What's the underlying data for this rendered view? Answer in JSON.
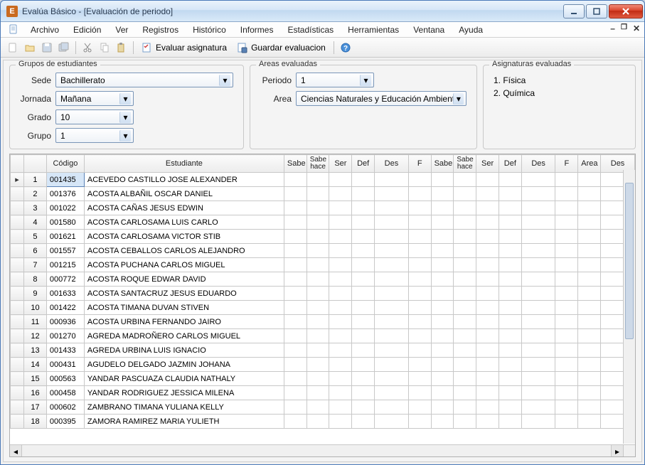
{
  "window": {
    "title": "Evalúa Básico - [Evaluación de periodo]"
  },
  "menu": [
    "Archivo",
    "Edición",
    "Ver",
    "Registros",
    "Histórico",
    "Informes",
    "Estadísticas",
    "Herramientas",
    "Ventana",
    "Ayuda"
  ],
  "toolbar": {
    "evaluar": "Evaluar asignatura",
    "guardar": "Guardar evaluacion"
  },
  "groups": {
    "grupos_title": "Grupos de estudiantes",
    "sede_label": "Sede",
    "sede_value": "Bachillerato",
    "jornada_label": "Jornada",
    "jornada_value": "Mañana",
    "grado_label": "Grado",
    "grado_value": "10",
    "grupo_label": "Grupo",
    "grupo_value": "1"
  },
  "areas": {
    "title": "Areas evaluadas",
    "periodo_label": "Periodo",
    "periodo_value": "1",
    "area_label": "Area",
    "area_value": "Ciencias Naturales y Educación Ambiental"
  },
  "subjects": {
    "title": "Asignaturas evaluadas",
    "items": [
      "1. Física",
      "2. Química"
    ]
  },
  "grid": {
    "columns": [
      "",
      "",
      "Código",
      "Estudiante",
      "Sabe",
      "Sabe hace",
      "Ser",
      "Def",
      "Des",
      "F",
      "Sabe",
      "Sabe hace",
      "Ser",
      "Def",
      "Des",
      "F",
      "Area",
      "Des"
    ],
    "rows": [
      {
        "n": 1,
        "code": "001435",
        "name": "ACEVEDO CASTILLO JOSE ALEXANDER",
        "marker": "▸"
      },
      {
        "n": 2,
        "code": "001376",
        "name": "ACOSTA ALBAÑIL OSCAR DANIEL"
      },
      {
        "n": 3,
        "code": "001022",
        "name": "ACOSTA CAÑAS JESUS EDWIN"
      },
      {
        "n": 4,
        "code": "001580",
        "name": "ACOSTA CARLOSAMA LUIS CARLO"
      },
      {
        "n": 5,
        "code": "001621",
        "name": "ACOSTA CARLOSAMA VICTOR STIB"
      },
      {
        "n": 6,
        "code": "001557",
        "name": "ACOSTA CEBALLOS CARLOS ALEJANDRO"
      },
      {
        "n": 7,
        "code": "001215",
        "name": "ACOSTA PUCHANA CARLOS MIGUEL"
      },
      {
        "n": 8,
        "code": "000772",
        "name": "ACOSTA ROQUE EDWAR DAVID"
      },
      {
        "n": 9,
        "code": "001633",
        "name": "ACOSTA SANTACRUZ JESUS EDUARDO"
      },
      {
        "n": 10,
        "code": "001422",
        "name": "ACOSTA TIMANA DUVAN STIVEN"
      },
      {
        "n": 11,
        "code": "000936",
        "name": "ACOSTA URBINA FERNANDO JAIRO"
      },
      {
        "n": 12,
        "code": "001270",
        "name": "AGREDA MADROÑERO CARLOS MIGUEL"
      },
      {
        "n": 13,
        "code": "001433",
        "name": "AGREDA URBINA LUIS IGNACIO"
      },
      {
        "n": 14,
        "code": "000431",
        "name": "AGUDELO DELGADO JAZMIN JOHANA"
      },
      {
        "n": 15,
        "code": "000563",
        "name": "YANDAR PASCUAZA CLAUDIA NATHALY"
      },
      {
        "n": 16,
        "code": "000458",
        "name": "YANDAR RODRIGUEZ JESSICA MILENA"
      },
      {
        "n": 17,
        "code": "000602",
        "name": "ZAMBRANO TIMANA YULIANA KELLY"
      },
      {
        "n": 18,
        "code": "000395",
        "name": "ZAMORA RAMIREZ MARIA YULIETH"
      }
    ]
  }
}
